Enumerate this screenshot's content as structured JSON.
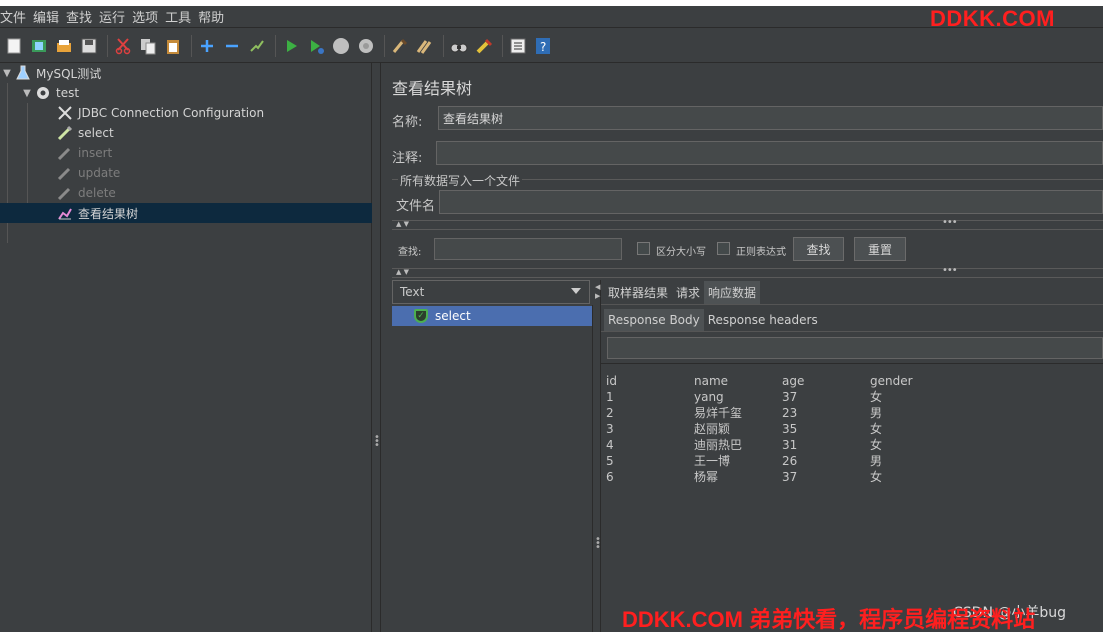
{
  "menu": [
    "文件",
    "编辑",
    "查找",
    "运行",
    "选项",
    "工具",
    "帮助"
  ],
  "watermark_top": "DDKK.COM",
  "watermark_bottom": "DDKK.COM 弟弟快看，程序员编程资料站",
  "csdn_mark": "CSDN @小羊bug",
  "toolbar_icons": [
    "new-icon",
    "templates-icon",
    "open-icon",
    "save-icon",
    "cut-icon",
    "copy-icon",
    "paste-icon",
    "expand-icon",
    "collapse-icon",
    "toggle-icon",
    "start-icon",
    "start-no-pause-icon",
    "stop-icon",
    "shutdown-icon",
    "clear-icon",
    "clear-all-icon",
    "search-icon",
    "reset-search-icon",
    "function-helper-icon",
    "help-icon"
  ],
  "tree": {
    "root": "MySQL测试",
    "thread_group": "test",
    "items": [
      {
        "label": "JDBC Connection Configuration",
        "disabled": false
      },
      {
        "label": "select",
        "disabled": false
      },
      {
        "label": "insert",
        "disabled": true
      },
      {
        "label": "update",
        "disabled": true
      },
      {
        "label": "delete",
        "disabled": true
      },
      {
        "label": "查看结果树",
        "disabled": false,
        "selected": true
      }
    ]
  },
  "panel": {
    "title": "查看结果树",
    "name_label": "名称:",
    "name_value": "查看结果树",
    "comment_label": "注释:",
    "comment_value": "",
    "file_group_title": "所有数据写入一个文件",
    "filename_label": "文件名",
    "filename_value": "",
    "search_label": "查找:",
    "search_value": "",
    "case_sensitive_label": "区分大小写",
    "regex_label": "正则表达式",
    "find_button": "查找",
    "reset_button": "重置",
    "renderer_value": "Text",
    "result_item": "select",
    "tabs": [
      "取样器结果",
      "请求",
      "响应数据"
    ],
    "active_tab": "响应数据",
    "subtabs": [
      "Response Body",
      "Response headers"
    ],
    "active_subtab": "Response Body"
  },
  "response_table": {
    "headers": [
      "id",
      "name",
      "age",
      "gender"
    ],
    "rows": [
      [
        "1",
        "yang",
        "37",
        "女"
      ],
      [
        "2",
        "易烊千玺",
        "23",
        "男"
      ],
      [
        "3",
        "赵丽颖",
        "35",
        "女"
      ],
      [
        "4",
        "迪丽热巴",
        "31",
        "女"
      ],
      [
        "5",
        "王一博",
        "26",
        "男"
      ],
      [
        "6",
        "杨幂",
        "37",
        "女"
      ]
    ]
  }
}
